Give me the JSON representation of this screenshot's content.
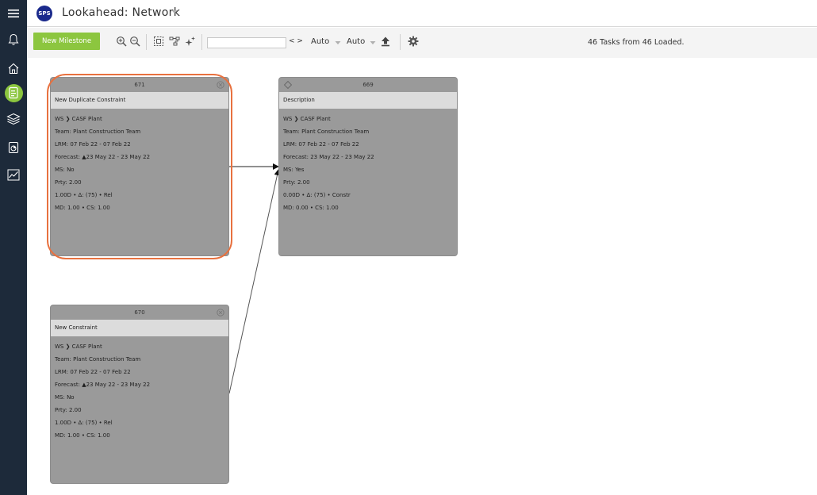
{
  "app": {
    "logo_text": "SPS",
    "title": "Lookahead: Network"
  },
  "rail": {
    "icons": [
      "menu-icon",
      "bell-icon",
      "home-icon",
      "schedule-icon",
      "layers-icon",
      "document-icon",
      "chart-icon"
    ],
    "active": "schedule-icon",
    "active_color": "#8cc63f"
  },
  "toolbar": {
    "new_milestone_label": "New Milestone",
    "search_value": "",
    "nav_arrows": "< >",
    "select_1": "Auto",
    "select_2": "Auto",
    "status": "46 Tasks from 46 Loaded."
  },
  "cards": [
    {
      "id": "671",
      "description": "New Duplicate Constraint",
      "lines": [
        "WS ❯ CASF Plant",
        "Team: Plant Construction Team",
        "LRM: 07 Feb 22 - 07 Feb 22",
        "Forecast: ▲23 May 22 - 23 May 22",
        "MS: No",
        "Prty: 2.00",
        "1.00D • Δ: (75) • Rel",
        "MD: 1.00 • CS: 1.00"
      ],
      "highlighted": true
    },
    {
      "id": "669",
      "description": "Description",
      "lines": [
        "WS ❯ CASF Plant",
        "Team: Plant Construction Team",
        "LRM: 07 Feb 22 - 07 Feb 22",
        "Forecast: 23 May 22 - 23 May 22",
        "MS: Yes",
        "Prty: 2.00",
        "0.00D • Δ: (75) • Constr",
        "MD: 0.00 • CS: 1.00"
      ],
      "milestone": true
    },
    {
      "id": "670",
      "description": "New Constraint",
      "lines": [
        "WS ❯ CASF Plant",
        "Team: Plant Construction Team",
        "LRM: 07 Feb 22 - 07 Feb 22",
        "Forecast: ▲23 May 22 - 23 May 22",
        "MS: No",
        "Prty: 2.00",
        "1.00D • Δ: (75) • Rel",
        "MD: 1.00 • CS: 1.00"
      ]
    }
  ],
  "colors": {
    "rail": "#1d2a3a",
    "accent": "#8cc63f",
    "highlight": "#e8713f",
    "card": "#9a9a9a"
  }
}
